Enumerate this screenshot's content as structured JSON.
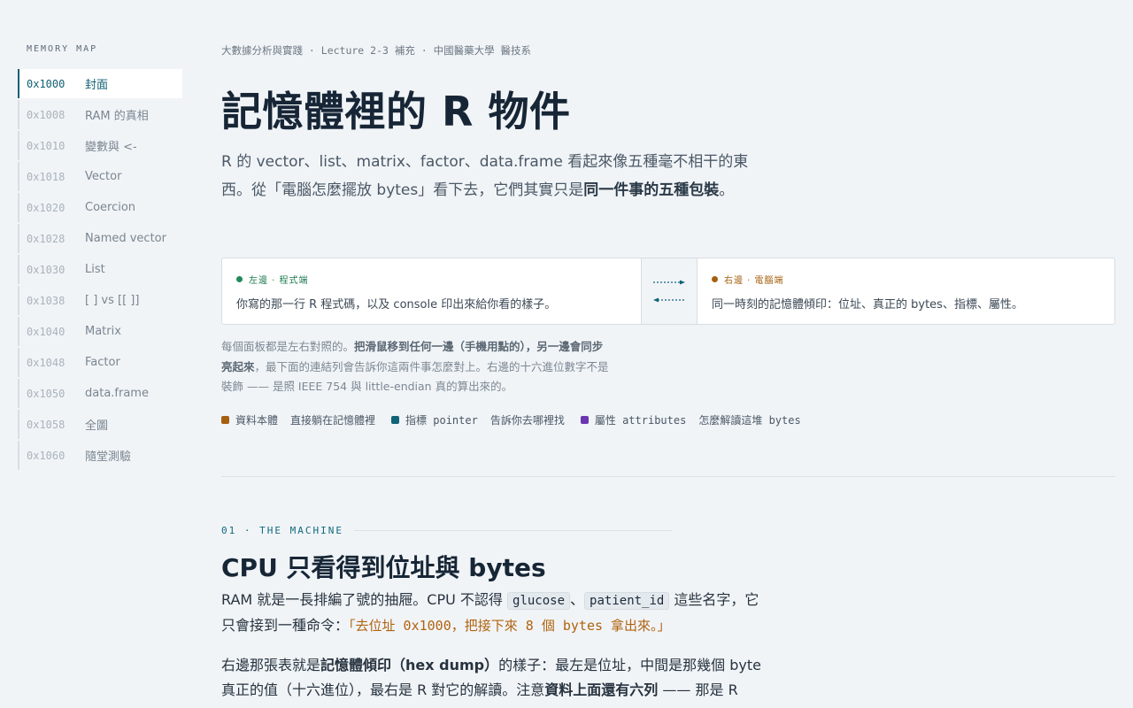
{
  "sidebar": {
    "title": "MEMORY MAP",
    "items": [
      {
        "addr": "0x1000",
        "label": "封面"
      },
      {
        "addr": "0x1008",
        "label": "RAM 的真相"
      },
      {
        "addr": "0x1010",
        "label": "變數與 <-"
      },
      {
        "addr": "0x1018",
        "label": "Vector"
      },
      {
        "addr": "0x1020",
        "label": "Coercion"
      },
      {
        "addr": "0x1028",
        "label": "Named vector"
      },
      {
        "addr": "0x1030",
        "label": "List"
      },
      {
        "addr": "0x1038",
        "label": "[ ] vs [[ ]]"
      },
      {
        "addr": "0x1040",
        "label": "Matrix"
      },
      {
        "addr": "0x1048",
        "label": "Factor"
      },
      {
        "addr": "0x1050",
        "label": "data.frame"
      },
      {
        "addr": "0x1058",
        "label": "全圖"
      },
      {
        "addr": "0x1060",
        "label": "隨堂測驗"
      }
    ]
  },
  "header": {
    "breadcrumb": "大數據分析與實踐 · Lecture 2-3 補充 · 中國醫藥大學 醫技系",
    "title": "記憶體裡的 R 物件",
    "lead_1": "R 的 vector、list、matrix、factor、data.frame 看起來像五種毫不相干的東西。從「電腦怎麼擺放 bytes」看下去，它們其實只是",
    "lead_bold": "同一件事的五種包裝",
    "lead_2": "。"
  },
  "split": {
    "left_label": "左邊 · 程式端",
    "left_text": "你寫的那一行 R 程式碼，以及 console 印出來給你看的樣子。",
    "right_label": "右邊 · 電腦端",
    "right_text": "同一時刻的記憶體傾印：位址、真正的 bytes、指標、屬性。"
  },
  "note": {
    "p1": "每個面板都是左右對照的。",
    "b1": "把滑鼠移到任何一邊（手機用點的），另一邊會同步亮起來",
    "p2": "，最下面的連結列會告訴你這兩件事怎麼對上。右邊的十六進位數字不是裝飾 —— 是照 IEEE 754 與 little-endian 真的算出來的。"
  },
  "legend": [
    {
      "name": "資料本體",
      "desc": "直接躺在記憶體裡",
      "color": "#a5600f"
    },
    {
      "name": "指標 pointer",
      "desc": "告訴你去哪裡找",
      "color": "#0f6478"
    },
    {
      "name": "屬性 attributes",
      "desc": "怎麼解讀這堆 bytes",
      "color": "#6a35b0"
    }
  ],
  "section1": {
    "eyebrow": "01 · THE MACHINE",
    "title": "CPU 只看得到位址與 bytes",
    "p1_a": "RAM 就是一長排編了號的抽屜。CPU 不認得 ",
    "code1": "glucose",
    "p1_sep": "、",
    "code2": "patient_id",
    "p1_b": " 這些名字，它只會接到一種命令：",
    "p1_quote": "「去位址 0x1000，把接下來 8 個 bytes 拿出來。」",
    "p2_a": "右邊那張表就是",
    "p2_b1": "記憶體傾印（hex dump）",
    "p2_b": "的樣子：最左是位址，中間是那幾個 byte 真正的值（十六進位），最右是 R 對它的解讀。注意",
    "p2_b2": "資料上面還有六列",
    "p2_c": " —— 那是 R"
  },
  "colors": {
    "accent": "#0f5f73",
    "left_dot": "#1f8a5a",
    "right_dot": "#a5600f",
    "left_label": "#1f7a52",
    "right_label": "#a5600f"
  }
}
